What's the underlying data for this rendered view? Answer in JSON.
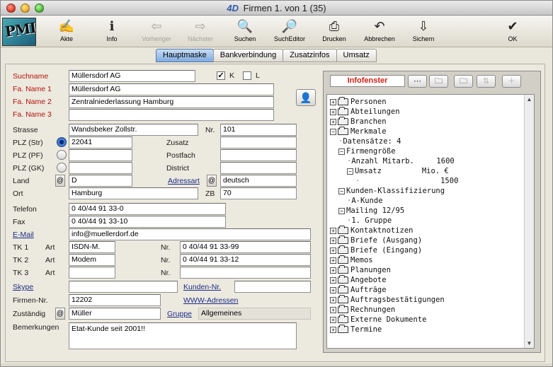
{
  "window": {
    "title_prefix": "4D",
    "title": "Firmen 1. von 1 (35)"
  },
  "app_logo": {
    "text": "PMI"
  },
  "toolbar": [
    {
      "label": "Akte",
      "icon": "✍",
      "name": "akte-button",
      "icon_name": "folder-pen-icon",
      "enabled": true
    },
    {
      "label": "Info",
      "icon": "ℹ",
      "name": "info-button",
      "icon_name": "info-icon",
      "enabled": true
    },
    {
      "label": "Vorheriger",
      "icon": "⇦",
      "name": "previous-button",
      "icon_name": "arrow-left-icon",
      "enabled": false
    },
    {
      "label": "Nächster",
      "icon": "⇨",
      "name": "next-button",
      "icon_name": "arrow-right-icon",
      "enabled": false
    },
    {
      "label": "Suchen",
      "icon": "🔍",
      "name": "search-button",
      "icon_name": "magnifier-icon",
      "enabled": true
    },
    {
      "label": "SuchEditor",
      "icon": "🔎",
      "name": "search-editor-button",
      "icon_name": "magnifier-doc-icon",
      "enabled": true
    },
    {
      "label": "Drucken",
      "icon": "⎙",
      "name": "print-button",
      "icon_name": "printer-icon",
      "enabled": true
    },
    {
      "label": "Abbrechen",
      "icon": "↶",
      "name": "cancel-button",
      "icon_name": "undo-arrow-icon",
      "enabled": true
    },
    {
      "label": "Sichern",
      "icon": "⇩",
      "name": "save-button",
      "icon_name": "save-arrow-icon",
      "enabled": true
    },
    {
      "label": "OK",
      "icon": "✔",
      "name": "ok-button",
      "icon_name": "checkmark-icon",
      "enabled": true
    }
  ],
  "tabs": [
    "Hauptmaske",
    "Bankverbindung",
    "Zusatzinfos",
    "Umsatz"
  ],
  "active_tab": "Hauptmaske",
  "form": {
    "suchname_label": "Suchname",
    "suchname": "Müllersdorf AG",
    "k_label": "K",
    "k_checked": true,
    "l_label": "L",
    "l_checked": false,
    "name1_label": "Fa. Name 1",
    "name1": "Müllersdorf AG",
    "name2_label": "Fa. Name 2",
    "name2": "Zentralniederlassung Hamburg",
    "name3_label": "Fa. Name 3",
    "name3": "",
    "strasse_label": "Strasse",
    "strasse": "Wandsbeker Zollstr.",
    "nr_label": "Nr.",
    "nr": "101",
    "plz_str_label": "PLZ (Str)",
    "plz_str": "22041",
    "zusatz_label": "Zusatz",
    "zusatz": "",
    "plz_pf_label": "PLZ (PF)",
    "plz_pf": "",
    "postfach_label": "Postfach",
    "postfach": "",
    "plz_gk_label": "PLZ (GK)",
    "plz_gk": "",
    "district_label": "District",
    "district": "",
    "land_label": "Land",
    "land": "D",
    "adressart_label": "Adressart",
    "adressart": "deutsch",
    "ort_label": "Ort",
    "ort": "Hamburg",
    "zb_label": "ZB",
    "zb": "70",
    "telefon_label": "Telefon",
    "telefon": "0 40/44 91 33-0",
    "fax_label": "Fax",
    "fax": "0 40/44 91 33-10",
    "email_label": "E-Mail",
    "email": "info@muellerdorf.de",
    "tk1_label": "TK 1",
    "tk1_art_label": "Art",
    "tk1_art": "ISDN-M.",
    "tk1_nr_label": "Nr.",
    "tk1_nr": "0 40/44 91 33-99",
    "tk2_label": "TK 2",
    "tk2_art_label": "Art",
    "tk2_art": "Modem",
    "tk2_nr_label": "Nr.",
    "tk2_nr": "0 40/44 91 33-12",
    "tk3_label": "TK 3",
    "tk3_art_label": "Art",
    "tk3_art": "",
    "tk3_nr_label": "Nr.",
    "tk3_nr": "",
    "skype_label": "Skype",
    "skype": "",
    "kunden_nr_label": "Kunden-Nr.",
    "kunden_nr": "",
    "firmen_nr_label": "Firmen-Nr.",
    "firmen_nr": "12202",
    "www_label": "WWW-Adressen",
    "zustaendig_label": "Zuständig",
    "zustaendig": "Müller",
    "gruppe_label": "Gruppe",
    "gruppe": "Allgemeines",
    "bemerkungen_label": "Bemerkungen",
    "bemerkungen": "Etat-Kunde seit 2001!!",
    "at_symbol": "@"
  },
  "info": {
    "title": "Infofenster",
    "tree": [
      {
        "text": "Personen",
        "type": "folder",
        "indent": 0,
        "pm": "+"
      },
      {
        "text": "Abteilungen",
        "type": "folder",
        "indent": 0,
        "pm": "+"
      },
      {
        "text": "Branchen",
        "type": "folder",
        "indent": 0,
        "pm": "+"
      },
      {
        "text": "Merkmale",
        "type": "folder",
        "indent": 0,
        "pm": "−"
      },
      {
        "text": "Datensätze: 4",
        "type": "leaf",
        "indent": 1,
        "pm": ""
      },
      {
        "text": "Firmengröße",
        "type": "leaf",
        "indent": 1,
        "pm": "−"
      },
      {
        "text": "Anzahl Mitarb.     1600",
        "type": "leaf",
        "indent": 2,
        "pm": ""
      },
      {
        "text": "Umsatz         Mio. €",
        "type": "leaf",
        "indent": 2,
        "pm": "−"
      },
      {
        "text": "                  1500",
        "type": "leaf",
        "indent": 3,
        "pm": ""
      },
      {
        "text": "Kunden-Klassifizierung",
        "type": "leaf",
        "indent": 1,
        "pm": "−"
      },
      {
        "text": "A-Kunde",
        "type": "leaf",
        "indent": 2,
        "pm": ""
      },
      {
        "text": "Mailing 12/95",
        "type": "leaf",
        "indent": 1,
        "pm": "−"
      },
      {
        "text": "1. Gruppe",
        "type": "leaf",
        "indent": 2,
        "pm": ""
      },
      {
        "text": "Kontaktnotizen",
        "type": "folder",
        "indent": 0,
        "pm": "+"
      },
      {
        "text": "Briefe (Ausgang)",
        "type": "folder",
        "indent": 0,
        "pm": "+"
      },
      {
        "text": "Briefe (Eingang)",
        "type": "folder",
        "indent": 0,
        "pm": "+"
      },
      {
        "text": "Memos",
        "type": "folder",
        "indent": 0,
        "pm": "+"
      },
      {
        "text": "Planungen",
        "type": "folder",
        "indent": 0,
        "pm": "+"
      },
      {
        "text": "Angebote",
        "type": "folder",
        "indent": 0,
        "pm": "+"
      },
      {
        "text": "Aufträge",
        "type": "folder",
        "indent": 0,
        "pm": "+"
      },
      {
        "text": "Auftragsbestätigungen",
        "type": "folder",
        "indent": 0,
        "pm": "+"
      },
      {
        "text": "Rechnungen",
        "type": "folder",
        "indent": 0,
        "pm": "+"
      },
      {
        "text": "Externe Dokumente",
        "type": "folder",
        "indent": 0,
        "pm": "+"
      },
      {
        "text": "Termine",
        "type": "folder",
        "indent": 0,
        "pm": "+"
      }
    ]
  },
  "colors": {
    "accent_red": "#b5120c",
    "link_blue": "#1c2c86",
    "tab_active": "#7fabe0"
  }
}
